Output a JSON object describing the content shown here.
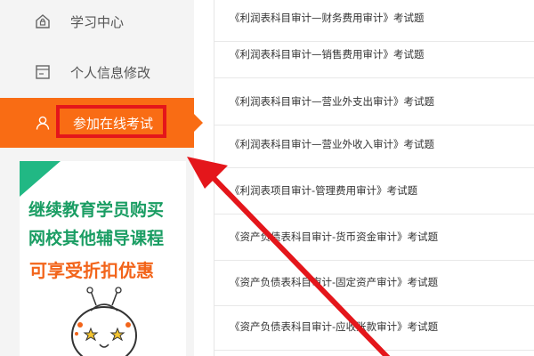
{
  "sidebar": {
    "items": [
      {
        "label": "学习中心",
        "icon": "house-lock-icon"
      },
      {
        "label": "个人信息修改",
        "icon": "id-card-icon"
      },
      {
        "label": "参加在线考试",
        "icon": "user-icon",
        "active": true
      }
    ]
  },
  "promo": {
    "line1": "继续教育学员购买",
    "line2": "网校其他辅导课程",
    "line3": "可享受折扣优惠"
  },
  "exams": [
    {
      "title": "《利润表科目审计—财务费用审计》考试题"
    },
    {
      "title": "《利润表科目审计—销售费用审计》考试题"
    },
    {
      "title": "《利润表科目审计—营业外支出审计》考试题"
    },
    {
      "title": "《利润表科目审计—营业外收入审计》考试题"
    },
    {
      "title": "《利润表项目审计-管理费用审计》考试题"
    },
    {
      "title": "《资产负债表科目审计-货币资金审计》考试题"
    },
    {
      "title": "《资产负债表科目审计-固定资产审计》考试题"
    },
    {
      "title": "《资产负债表科目审计-应收账款审计》考试题"
    }
  ],
  "colors": {
    "accent": "#f96c14",
    "highlight": "#e4161b",
    "promo_green": "#1a9d63",
    "promo_orange": "#f2641a"
  }
}
